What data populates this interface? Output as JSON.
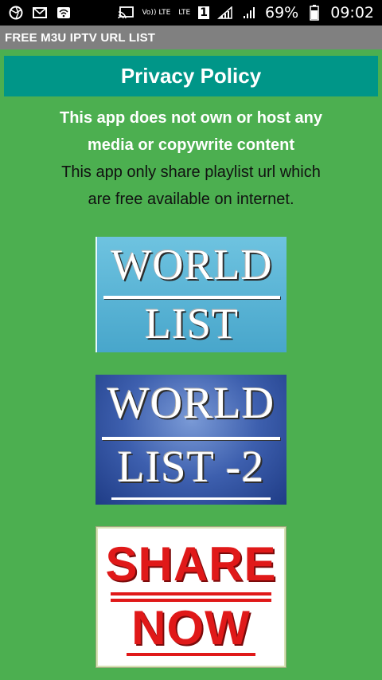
{
  "status_bar": {
    "volte": "Vo)) LTE",
    "lte": "LTE",
    "sim": "1",
    "battery": "69%",
    "time": "09:02"
  },
  "app_bar": {
    "title": "FREE M3U IPTV URL LIST"
  },
  "privacy_button": {
    "label": "Privacy Policy"
  },
  "disclaimer": {
    "line1": "This app does not own or host any",
    "line2": "media or copywrite content",
    "line3": "This app only share playlist url which",
    "line4": "are free available on internet."
  },
  "tiles": {
    "world_list": {
      "top": "WORLD",
      "bottom": "LIST"
    },
    "world_list_2": {
      "top": "WORLD",
      "bottom": "LIST -2"
    },
    "share_now": {
      "top": "SHARE",
      "bottom": "NOW"
    }
  }
}
